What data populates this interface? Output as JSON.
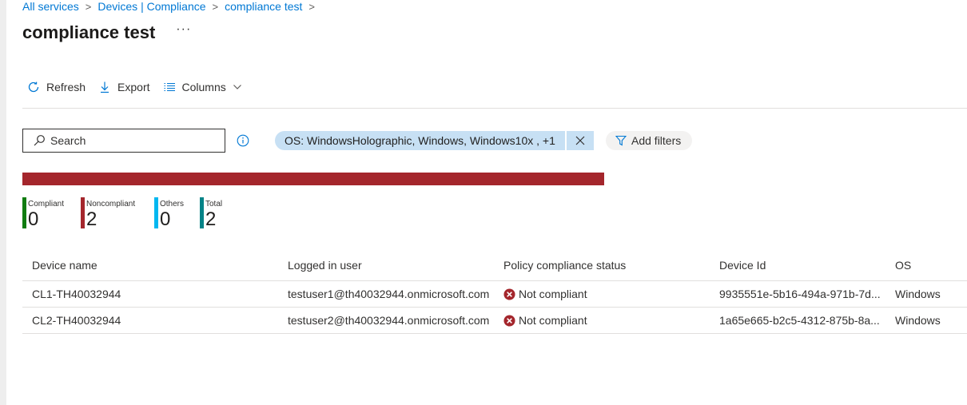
{
  "breadcrumb": {
    "items": [
      "All services",
      "Devices | Compliance",
      "compliance test"
    ]
  },
  "page": {
    "title": "compliance test",
    "more_label": "···"
  },
  "toolbar": {
    "refresh_label": "Refresh",
    "export_label": "Export",
    "columns_label": "Columns"
  },
  "search": {
    "placeholder": "Search",
    "value": ""
  },
  "filter": {
    "label": "OS: WindowsHolographic, Windows, Windows10x , +1",
    "add_filters_label": "Add filters"
  },
  "summary": {
    "bar_color": "#a4262c",
    "noncompliant_fraction": 1.0,
    "stats": [
      {
        "label": "Compliant",
        "value": "0",
        "color": "#107c10"
      },
      {
        "label": "Noncompliant",
        "value": "2",
        "color": "#a4262c"
      },
      {
        "label": "Others",
        "value": "0",
        "color": "#00b7f0"
      },
      {
        "label": "Total",
        "value": "2",
        "color": "#038387"
      }
    ]
  },
  "table": {
    "columns": [
      "Device name",
      "Logged in user",
      "Policy compliance status",
      "Device Id",
      "OS"
    ],
    "rows": [
      {
        "device_name": "CL1-TH40032944",
        "user": "testuser1@th40032944.onmicrosoft.com",
        "status": "Not compliant",
        "device_id": "9935551e-5b16-494a-971b-7d...",
        "os": "Windows"
      },
      {
        "device_name": "CL2-TH40032944",
        "user": "testuser2@th40032944.onmicrosoft.com",
        "status": "Not compliant",
        "device_id": "1a65e665-b2c5-4312-875b-8a...",
        "os": "Windows"
      }
    ]
  },
  "icons": {
    "status": "error-circle-icon",
    "refresh": "refresh-icon",
    "export": "download-icon",
    "columns": "list-icon",
    "filter": "filter-icon",
    "search": "search-icon",
    "info": "info-icon"
  },
  "colors": {
    "accent": "#0078d4",
    "error": "#a4262c",
    "pill": "#c7e0f4"
  }
}
